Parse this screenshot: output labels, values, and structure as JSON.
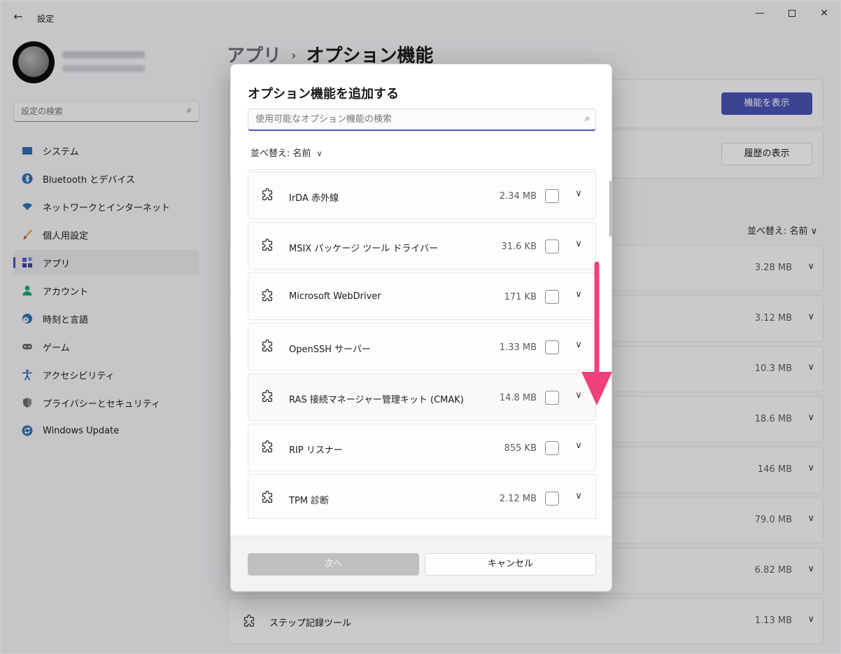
{
  "window": {
    "title": "設定",
    "back_icon": "arrow-left-icon",
    "controls": {
      "minimize": "—",
      "close": "✕"
    }
  },
  "sidebar": {
    "search_placeholder": "設定の検索",
    "items": [
      {
        "label": "システム",
        "icon": "system-icon",
        "color": "#2f6fb3"
      },
      {
        "label": "Bluetooth とデバイス",
        "icon": "bluetooth-icon",
        "color": "#2f6fb3"
      },
      {
        "label": "ネットワークとインターネット",
        "icon": "wifi-icon",
        "color": "#2f6fb3"
      },
      {
        "label": "個人用設定",
        "icon": "brush-icon",
        "color": "#c0643c"
      },
      {
        "label": "アプリ",
        "icon": "apps-icon",
        "color": "#4a52b3",
        "selected": true
      },
      {
        "label": "アカウント",
        "icon": "account-icon",
        "color": "#22a07a"
      },
      {
        "label": "時刻と言語",
        "icon": "globe-clock-icon",
        "color": "#2f6fb3"
      },
      {
        "label": "ゲーム",
        "icon": "gamepad-icon",
        "color": "#6b6b6b"
      },
      {
        "label": "アクセシビリティ",
        "icon": "accessibility-icon",
        "color": "#2f6fb3"
      },
      {
        "label": "プライバシーとセキュリティ",
        "icon": "shield-icon",
        "color": "#6b6b6b"
      },
      {
        "label": "Windows Update",
        "icon": "update-icon",
        "color": "#2f6fb3"
      }
    ]
  },
  "main": {
    "breadcrumb": {
      "parent": "アプリ",
      "separator": "›",
      "current": "オプション機能"
    },
    "view_features_button": "機能を表示",
    "view_history_button": "履歴の表示",
    "sort_label": "並べ替え: 名前",
    "installed_rows": [
      {
        "name": "",
        "size": "3.28 MB"
      },
      {
        "name": "",
        "size": "3.12 MB"
      },
      {
        "name": "",
        "size": "10.3 MB"
      },
      {
        "name": "",
        "size": "18.6 MB"
      },
      {
        "name": "",
        "size": "146 MB"
      },
      {
        "name": "",
        "size": "79.0 MB"
      },
      {
        "name": "",
        "size": "6.82 MB"
      },
      {
        "name": "ステップ記録ツール",
        "size": "1.13 MB"
      }
    ]
  },
  "dialog": {
    "title": "オプション機能を追加する",
    "search_placeholder": "使用可能なオプション機能の検索",
    "sort_label": "並べ替え: 名前",
    "features": [
      {
        "name": "IrDA 赤外線",
        "size": "2.34 MB",
        "checked": false
      },
      {
        "name": "MSIX パッケージ ツール ドライバー",
        "size": "31.6 KB",
        "checked": false
      },
      {
        "name": "Microsoft WebDriver",
        "size": "171 KB",
        "checked": false
      },
      {
        "name": "OpenSSH サーバー",
        "size": "1.33 MB",
        "checked": false
      },
      {
        "name": "RAS 接続マネージャー管理キット (CMAK)",
        "size": "14.8 MB",
        "checked": false
      },
      {
        "name": "RIP リスナー",
        "size": "855 KB",
        "checked": false
      },
      {
        "name": "TPM 診断",
        "size": "2.12 MB",
        "checked": false
      }
    ],
    "next_button": "次へ",
    "cancel_button": "キャンセル"
  },
  "colors": {
    "accent": "#4a52b3",
    "annotation_arrow": "#f0407a"
  }
}
